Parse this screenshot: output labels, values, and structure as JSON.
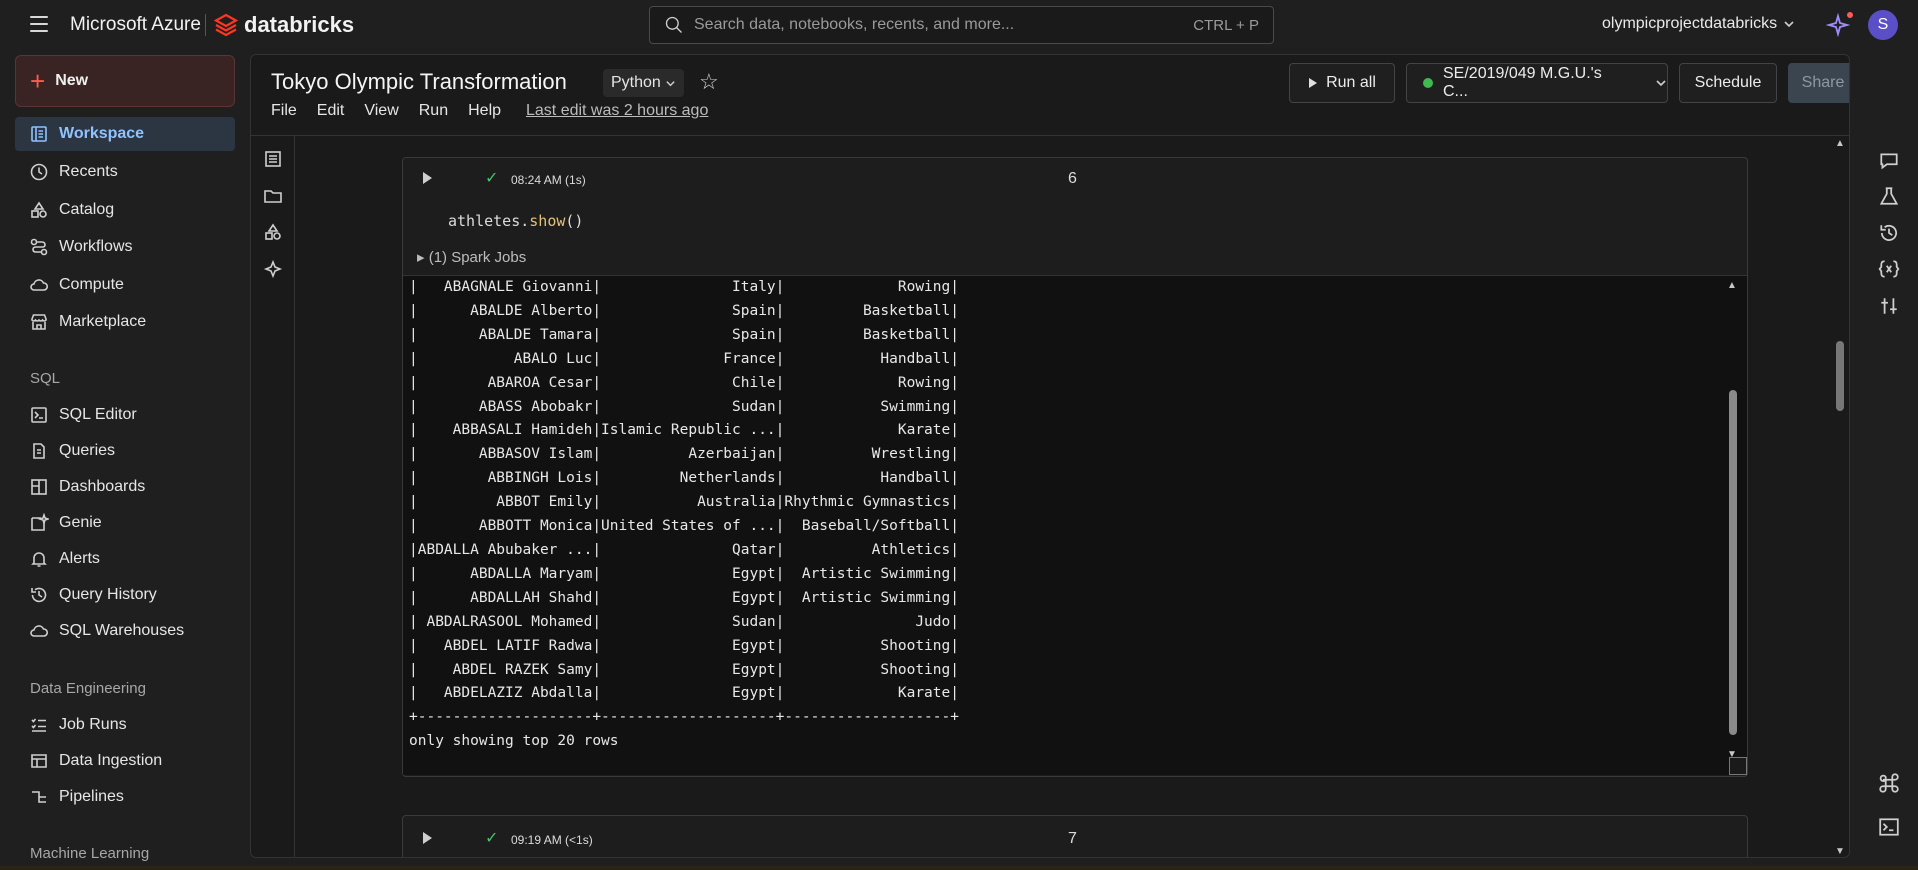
{
  "topbar": {
    "brand_azure": "Microsoft Azure",
    "brand_databricks": "databricks",
    "search_placeholder": "Search data, notebooks, recents, and more...",
    "search_shortcut": "CTRL + P",
    "workspace_name": "olympicprojectdatabricks",
    "avatar_initial": "S"
  },
  "sidebar": {
    "new_label": "New",
    "items": [
      {
        "label": "Workspace",
        "icon": "workspace-icon",
        "active": true
      },
      {
        "label": "Recents",
        "icon": "clock-icon"
      },
      {
        "label": "Catalog",
        "icon": "catalog-icon"
      },
      {
        "label": "Workflows",
        "icon": "workflows-icon"
      },
      {
        "label": "Compute",
        "icon": "cloud-icon"
      },
      {
        "label": "Marketplace",
        "icon": "store-icon"
      }
    ],
    "sql_header": "SQL",
    "sql_items": [
      {
        "label": "SQL Editor",
        "icon": "sql-editor-icon"
      },
      {
        "label": "Queries",
        "icon": "queries-icon"
      },
      {
        "label": "Dashboards",
        "icon": "dashboards-icon"
      },
      {
        "label": "Genie",
        "icon": "genie-icon"
      },
      {
        "label": "Alerts",
        "icon": "bell-icon"
      },
      {
        "label": "Query History",
        "icon": "history-icon"
      },
      {
        "label": "SQL Warehouses",
        "icon": "cloud-icon"
      }
    ],
    "de_header": "Data Engineering",
    "de_items": [
      {
        "label": "Job Runs",
        "icon": "list-icon"
      },
      {
        "label": "Data Ingestion",
        "icon": "ingest-icon"
      },
      {
        "label": "Pipelines",
        "icon": "pipelines-icon"
      }
    ],
    "ml_header": "Machine Learning"
  },
  "notebook": {
    "title": "Tokyo Olympic Transformation",
    "language": "Python",
    "menu": [
      "File",
      "Edit",
      "View",
      "Run",
      "Help"
    ],
    "last_edit": "Last edit was 2 hours ago",
    "run_all": "Run all",
    "cluster": "SE/2019/049 M.G.U.'s C...",
    "cluster_status_color": "#3fb950",
    "schedule": "Schedule",
    "share": "Share"
  },
  "cell6": {
    "time": "08:24 AM (1s)",
    "number": "6",
    "code_obj": "athletes.",
    "code_fn": "show",
    "code_end": "()",
    "spark_jobs": "(1) Spark Jobs",
    "output_rows": [
      "|   ABAGNALE Giovanni|               Italy|             Rowing|",
      "|      ABALDE Alberto|               Spain|         Basketball|",
      "|       ABALDE Tamara|               Spain|         Basketball|",
      "|           ABALO Luc|              France|           Handball|",
      "|        ABAROA Cesar|               Chile|             Rowing|",
      "|       ABASS Abobakr|               Sudan|           Swimming|",
      "|    ABBASALI Hamideh|Islamic Republic ...|             Karate|",
      "|       ABBASOV Islam|          Azerbaijan|          Wrestling|",
      "|        ABBINGH Lois|         Netherlands|           Handball|",
      "|         ABBOT Emily|           Australia|Rhythmic Gymnastics|",
      "|       ABBOTT Monica|United States of ...|  Baseball/Softball|",
      "|ABDALLA Abubaker ...|               Qatar|          Athletics|",
      "|      ABDALLA Maryam|               Egypt|  Artistic Swimming|",
      "|      ABDALLAH Shahd|               Egypt|  Artistic Swimming|",
      "| ABDALRASOOL Mohamed|               Sudan|               Judo|",
      "|   ABDEL LATIF Radwa|               Egypt|           Shooting|",
      "|    ABDEL RAZEK Samy|               Egypt|           Shooting|",
      "|   ABDELAZIZ Abdalla|               Egypt|             Karate|",
      "+--------------------+--------------------+-------------------+",
      "only showing top 20 rows"
    ]
  },
  "cell7": {
    "time": "09:19 AM (<1s)",
    "number": "7"
  }
}
